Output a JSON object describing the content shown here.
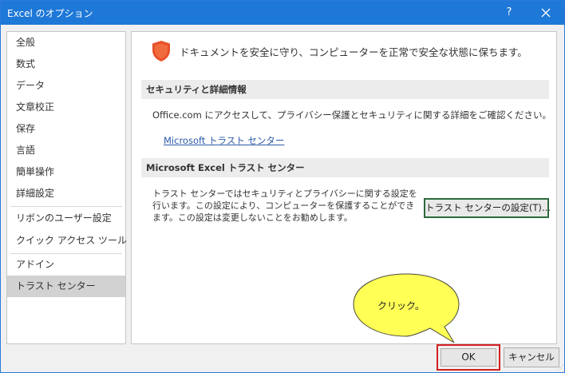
{
  "window": {
    "title": "Excel のオプション",
    "help_label": "?"
  },
  "sidebar": {
    "items": [
      {
        "label": "全般"
      },
      {
        "label": "数式"
      },
      {
        "label": "データ"
      },
      {
        "label": "文章校正"
      },
      {
        "label": "保存"
      },
      {
        "label": "言語"
      },
      {
        "label": "簡単操作"
      },
      {
        "label": "詳細設定"
      },
      {
        "label": "リボンのユーザー設定"
      },
      {
        "label": "クイック アクセス ツール バー"
      },
      {
        "label": "アドイン"
      },
      {
        "label": "トラスト センター"
      }
    ],
    "selected": "トラスト センター"
  },
  "main": {
    "headline": "ドキュメントを安全に守り、コンピューターを正常で安全な状態に保ちます。",
    "security_section": {
      "heading": "セキュリティと詳細情報",
      "description": "Office.com にアクセスして、プライバシー保護とセキュリティに関する詳細をご確認ください。",
      "link": "Microsoft トラスト センター"
    },
    "trust_section": {
      "heading": "Microsoft Excel トラスト センター",
      "text": "トラスト センターではセキュリティとプライバシーに関する設定を行います。この設定により、コンピューターを保護することができます。この設定は変更しないことをお勧めします。",
      "button": "トラスト センターの設定(T)..."
    }
  },
  "callout": {
    "text": "クリック。"
  },
  "footer": {
    "ok": "OK",
    "cancel": "キャンセル"
  },
  "colors": {
    "titlebar": "#1e78d7",
    "selected_item": "#d2d2d2",
    "shield": "#e8512a",
    "link": "#2e5ba8",
    "balloon": "#ffff55",
    "highlight": "#d42020"
  },
  "icons": {
    "shield": "shield-icon",
    "close": "close-icon"
  }
}
